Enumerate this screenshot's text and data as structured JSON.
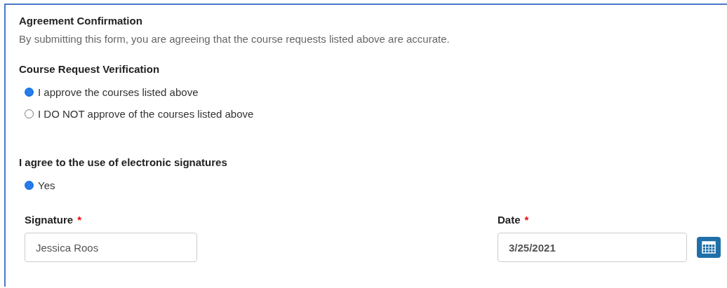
{
  "agreement": {
    "title": "Agreement Confirmation",
    "description": "By submitting this form, you are agreeing that the course requests listed above are accurate."
  },
  "verification": {
    "label": "Course Request Verification",
    "options": [
      {
        "label": "I approve the courses listed above",
        "selected": true
      },
      {
        "label": "I DO NOT approve of the courses listed above",
        "selected": false
      }
    ]
  },
  "esignature": {
    "label": "I agree to the use of electronic signatures",
    "options": [
      {
        "label": "Yes",
        "selected": true
      }
    ]
  },
  "signature": {
    "label": "Signature",
    "required_mark": "*",
    "value": "Jessica Roos"
  },
  "date": {
    "label": "Date",
    "required_mark": "*",
    "value": "3/25/2021"
  }
}
